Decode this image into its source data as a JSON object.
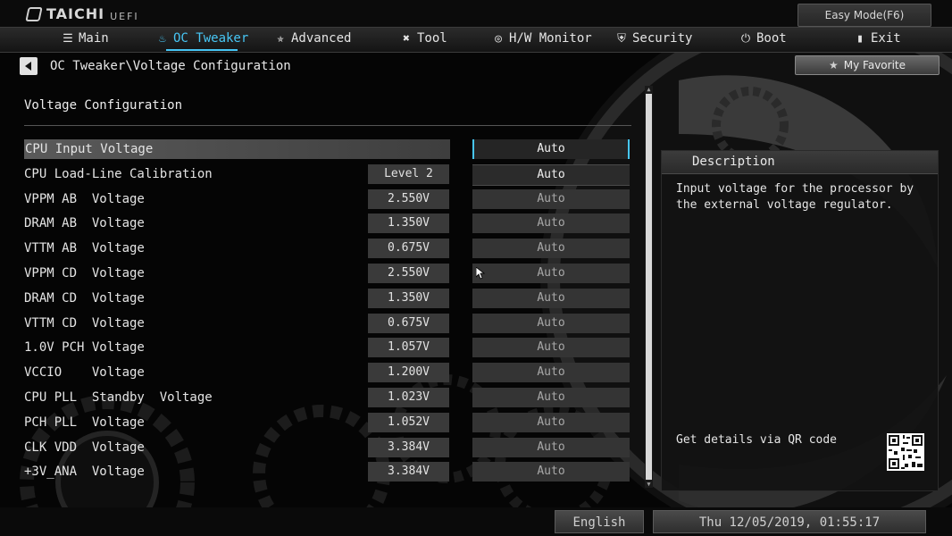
{
  "brand": {
    "name": "TAICHI",
    "suffix": "UEFI"
  },
  "easy_mode_label": "Easy Mode(F6)",
  "nav": [
    {
      "label": "Main",
      "icon": "list-icon"
    },
    {
      "label": "OC Tweaker",
      "icon": "flame-icon",
      "active": true
    },
    {
      "label": "Advanced",
      "icon": "star-icon"
    },
    {
      "label": "Tool",
      "icon": "tools-icon"
    },
    {
      "label": "H/W Monitor",
      "icon": "monitor-icon"
    },
    {
      "label": "Security",
      "icon": "shield-icon"
    },
    {
      "label": "Boot",
      "icon": "power-icon"
    },
    {
      "label": "Exit",
      "icon": "exit-icon"
    }
  ],
  "breadcrumb": "OC Tweaker\\Voltage Configuration",
  "my_favorite_label": "My Favorite",
  "section_title": "Voltage Configuration",
  "rows": [
    {
      "label": "CPU Input Voltage",
      "value": "",
      "setting": "Auto"
    },
    {
      "label": "CPU Load-Line Calibration",
      "value": "Level 2",
      "setting": "Auto"
    },
    {
      "label": "VPPM AB  Voltage",
      "value": "2.550V",
      "setting": "Auto"
    },
    {
      "label": "DRAM AB  Voltage",
      "value": "1.350V",
      "setting": "Auto"
    },
    {
      "label": "VTTM AB  Voltage",
      "value": "0.675V",
      "setting": "Auto"
    },
    {
      "label": "VPPM CD  Voltage",
      "value": "2.550V",
      "setting": "Auto"
    },
    {
      "label": "DRAM CD  Voltage",
      "value": "1.350V",
      "setting": "Auto"
    },
    {
      "label": "VTTM CD  Voltage",
      "value": "0.675V",
      "setting": "Auto"
    },
    {
      "label": "1.0V PCH Voltage",
      "value": "1.057V",
      "setting": "Auto"
    },
    {
      "label": "VCCIO    Voltage",
      "value": "1.200V",
      "setting": "Auto"
    },
    {
      "label": "CPU PLL  Standby  Voltage",
      "value": "1.023V",
      "setting": "Auto"
    },
    {
      "label": "PCH PLL  Voltage",
      "value": "1.052V",
      "setting": "Auto"
    },
    {
      "label": "CLK VDD  Voltage",
      "value": "3.384V",
      "setting": "Auto"
    },
    {
      "label": "+3V_ANA  Voltage",
      "value": "3.384V",
      "setting": "Auto"
    }
  ],
  "description": {
    "title": "Description",
    "text": "Input voltage for the processor by the external voltage regulator.",
    "qr_label": "Get details via QR code"
  },
  "status": {
    "language": "English",
    "datetime": "Thu 12/05/2019, 01:55:17"
  },
  "colors": {
    "accent": "#47c6f5"
  }
}
